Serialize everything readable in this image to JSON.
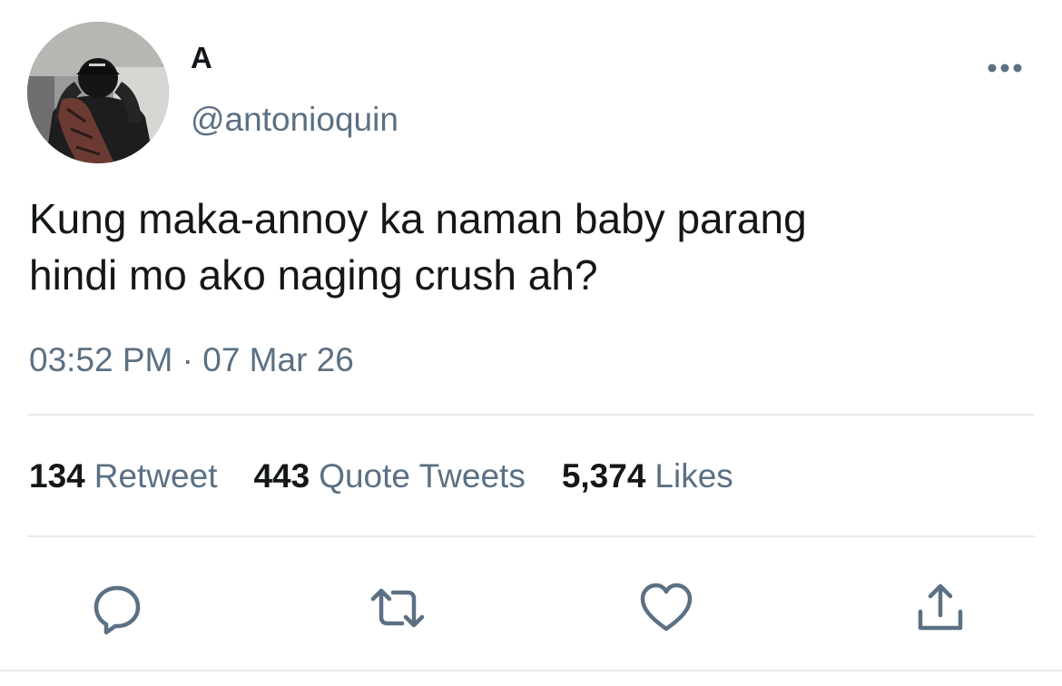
{
  "author": {
    "display_name": "A",
    "handle": "@antonioquin"
  },
  "tweet": {
    "text_lines": [
      "Kung maka-annoy ka naman baby parang",
      "hindi mo ako naging crush ah?"
    ],
    "timestamp": "03:52 PM · 07 Mar 26"
  },
  "stats": [
    {
      "value": "134",
      "label": "Retweet"
    },
    {
      "value": "443",
      "label": "Quote Tweets"
    },
    {
      "value": "5,374",
      "label": "Likes"
    }
  ],
  "icons": {
    "more": "more-horizontal-icon",
    "reply": "reply-bubble-icon",
    "retweet": "retweet-arrows-icon",
    "like": "heart-icon",
    "share": "share-upload-icon"
  },
  "colors": {
    "primary_text": "#14171a",
    "secondary_text": "#5b7083",
    "divider": "#e6ecf0",
    "background": "#ffffff"
  }
}
